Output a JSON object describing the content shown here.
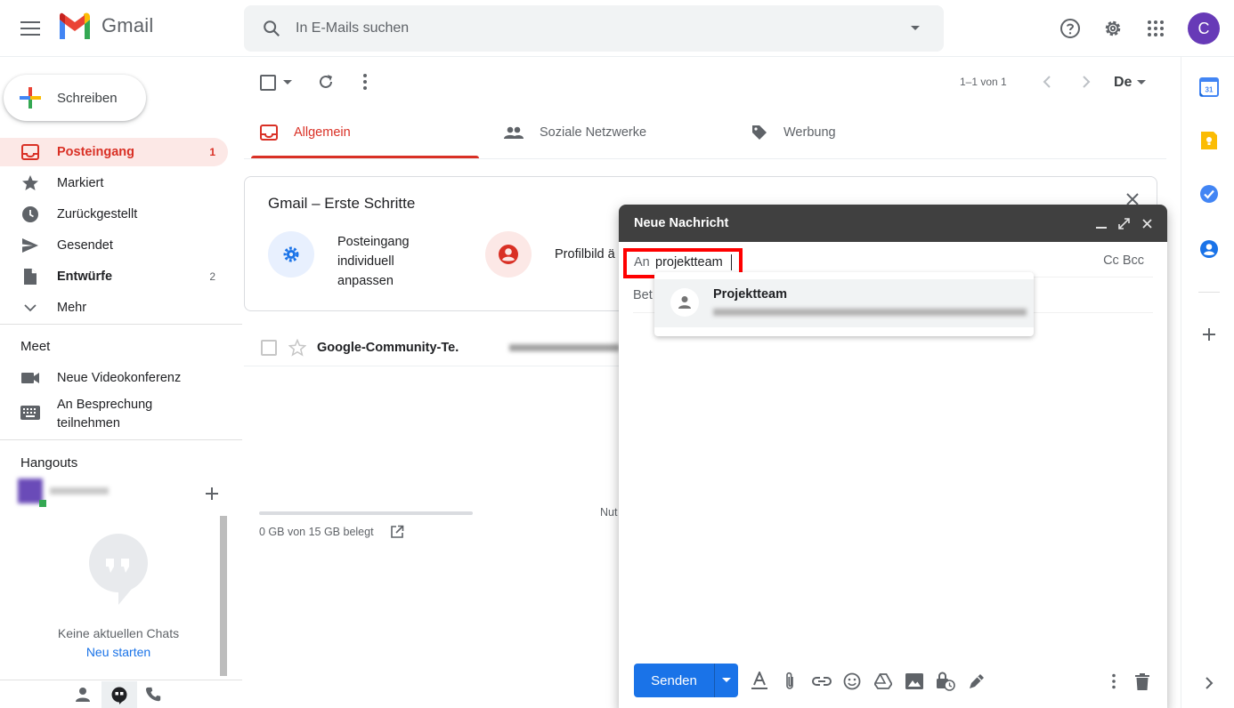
{
  "app": {
    "name": "Gmail"
  },
  "search": {
    "placeholder": "In E-Mails suchen"
  },
  "user": {
    "initial": "C"
  },
  "sidebar": {
    "compose_label": "Schreiben",
    "items": [
      {
        "label": "Posteingang",
        "count": "1"
      },
      {
        "label": "Markiert"
      },
      {
        "label": "Zurückgestellt"
      },
      {
        "label": "Gesendet"
      },
      {
        "label": "Entwürfe",
        "count": "2"
      },
      {
        "label": "Mehr"
      }
    ],
    "meet": {
      "title": "Meet",
      "items": [
        {
          "label": "Neue Videokonferenz"
        },
        {
          "label_line1": "An Besprechung",
          "label_line2": "teilnehmen"
        }
      ]
    },
    "hangouts": {
      "title": "Hangouts",
      "empty_text": "Keine aktuellen Chats",
      "start_link": "Neu starten"
    }
  },
  "toolbar": {
    "pager": "1–1 von 1",
    "input_tool": "De"
  },
  "tabs": [
    {
      "label": "Allgemein",
      "active": true
    },
    {
      "label": "Soziale Netzwerke"
    },
    {
      "label": "Werbung"
    }
  ],
  "getting_started": {
    "title": "Gmail – Erste Schritte",
    "step1": {
      "line1": "Posteingang",
      "line2": "individuell",
      "line3": "anpassen"
    },
    "step2": {
      "label": "Profilbild ä"
    }
  },
  "emails": [
    {
      "sender": "Google-Community-Te."
    }
  ],
  "storage": {
    "text": "0 GB von 15 GB belegt"
  },
  "footer_partial": "Nut",
  "compose": {
    "title": "Neue Nachricht",
    "to_label": "An",
    "to_value": "projektteam",
    "cc_bcc": "Cc Bcc",
    "subject_partial": "Bet",
    "suggestion": {
      "name": "Projektteam"
    },
    "send_label": "Senden"
  },
  "colors": {
    "accent_red": "#d93025",
    "active_bg": "#fce8e6",
    "send_blue": "#1a73e8",
    "compose_header": "#404040",
    "avatar": "#673ab7",
    "highlight": "#ff0000"
  }
}
